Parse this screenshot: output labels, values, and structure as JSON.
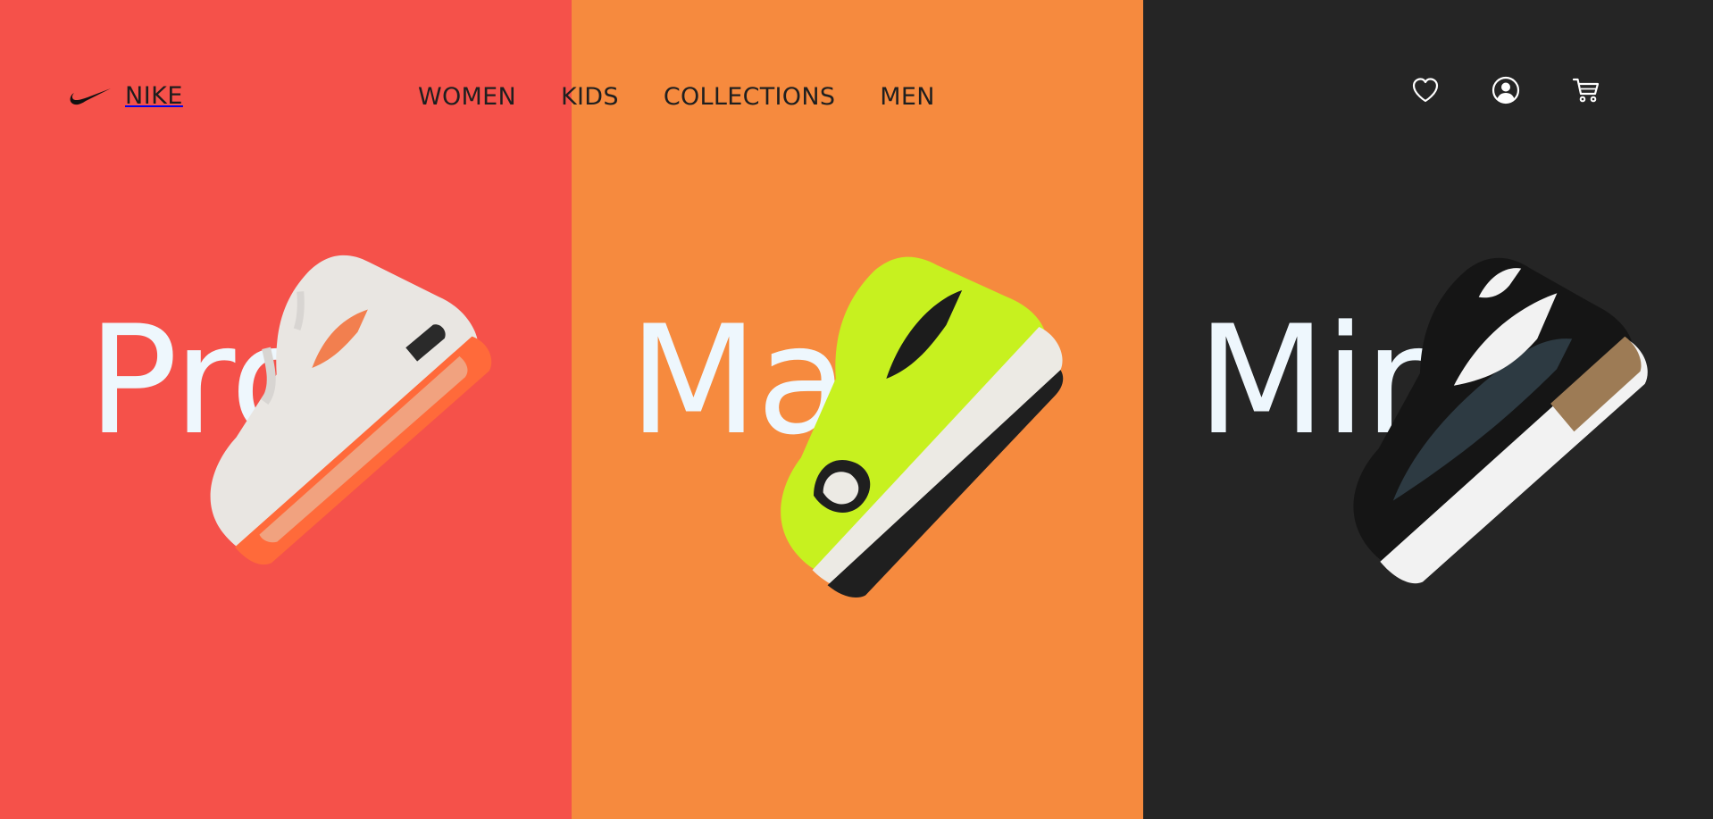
{
  "brand": {
    "name": "NIKE",
    "logo_icon": "nike-swoosh-icon"
  },
  "nav": {
    "items": [
      {
        "label": "WOMEN"
      },
      {
        "label": "KIDS"
      },
      {
        "label": "COLLECTIONS"
      },
      {
        "label": "MEN"
      }
    ]
  },
  "actions": {
    "icons": [
      "heart-icon",
      "user-account-icon",
      "shopping-cart-icon"
    ]
  },
  "panels": [
    {
      "word": "Pro",
      "background": "#f5514a",
      "shoe_icon": "sneaker-white-orange-icon"
    },
    {
      "word": "Max",
      "background": "#f68a3e",
      "shoe_icon": "sneaker-volt-green-icon"
    },
    {
      "word": "Mir",
      "background": "#252525",
      "shoe_icon": "sneaker-black-white-icon"
    }
  ],
  "colors": {
    "panel_red": "#f5514a",
    "panel_orange": "#f68a3e",
    "panel_dark": "#252525",
    "headline_text": "#eef7fd",
    "nav_text": "#1f1f1f"
  }
}
